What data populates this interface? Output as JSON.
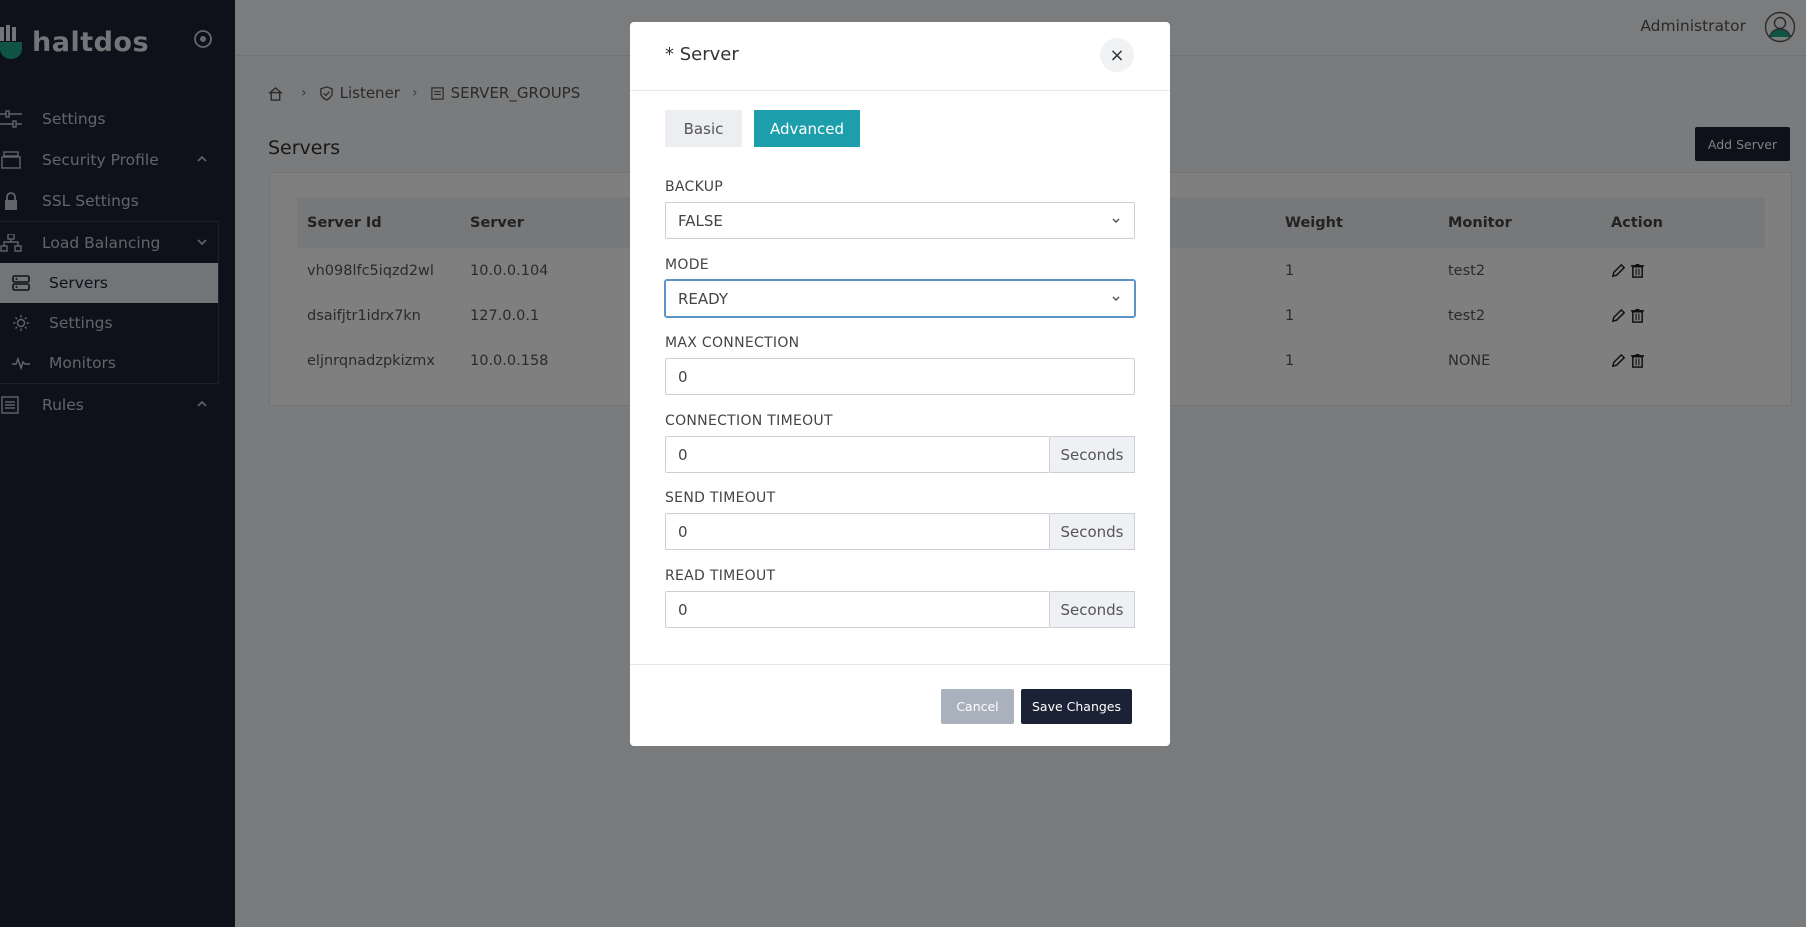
{
  "brand": {
    "name": "haltdos",
    "accent": "#1d9eab",
    "dark": "#1c2235"
  },
  "sidebar": {
    "items": [
      {
        "label": "Settings",
        "icon": "sliders-icon"
      },
      {
        "label": "Security Profile",
        "icon": "layers-icon"
      },
      {
        "label": "SSL Settings",
        "icon": "lock-icon"
      },
      {
        "label": "Load Balancing",
        "icon": "sitemap-icon"
      },
      {
        "label": "Rules",
        "icon": "list-icon"
      }
    ],
    "sub_items": [
      {
        "label": "Servers",
        "icon": "server-icon",
        "active": true
      },
      {
        "label": "Settings",
        "icon": "sun-icon"
      },
      {
        "label": "Monitors",
        "icon": "pulse-icon"
      }
    ]
  },
  "topbar": {
    "user": "Administrator"
  },
  "breadcrumb": {
    "items": [
      "Listener",
      "SERVER_GROUPS"
    ]
  },
  "page": {
    "title": "Servers",
    "add_button": "Add Server"
  },
  "table": {
    "headers": [
      "Server Id",
      "Server",
      "Weight",
      "Monitor",
      "Action"
    ],
    "rows": [
      {
        "id": "vh098lfc5iqzd2wl",
        "server": "10.0.0.104",
        "weight": "1",
        "monitor": "test2"
      },
      {
        "id": "dsaifjtr1idrx7kn",
        "server": "127.0.0.1",
        "weight": "1",
        "monitor": "test2"
      },
      {
        "id": "eljnrqnadzpkizmx",
        "server": "10.0.0.158",
        "weight": "1",
        "monitor": "NONE"
      }
    ]
  },
  "modal": {
    "title": "* Server",
    "close": "×",
    "tabs": {
      "basic": "Basic",
      "advanced": "Advanced",
      "active": "advanced"
    },
    "fields": {
      "backup": {
        "label": "BACKUP",
        "value": "FALSE"
      },
      "mode": {
        "label": "MODE",
        "value": "READY"
      },
      "max_connection": {
        "label": "MAX CONNECTION",
        "value": "0"
      },
      "connection_timeout": {
        "label": "CONNECTION TIMEOUT",
        "value": "0",
        "unit": "Seconds"
      },
      "send_timeout": {
        "label": "SEND TIMEOUT",
        "value": "0",
        "unit": "Seconds"
      },
      "read_timeout": {
        "label": "READ TIMEOUT",
        "value": "0",
        "unit": "Seconds"
      }
    },
    "cancel": "Cancel",
    "save": "Save Changes"
  }
}
